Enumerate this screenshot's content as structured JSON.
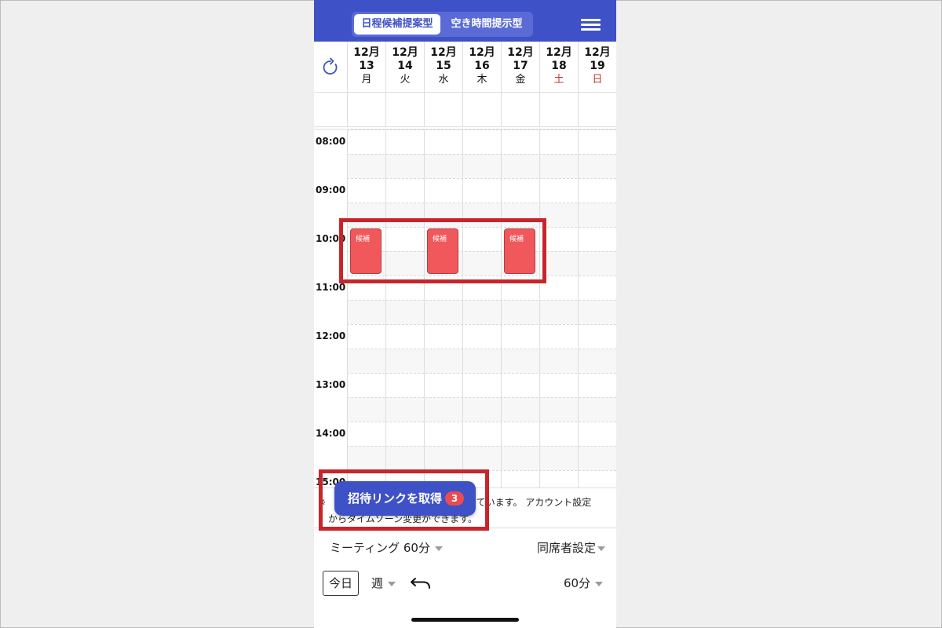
{
  "header": {
    "mode_tabs": [
      "日程候補提案型",
      "空き時間提示型"
    ],
    "active_tab": 0,
    "menu_icon": "hamburger-menu-icon",
    "color": "#3f51c7"
  },
  "days": [
    {
      "month": "12月",
      "date": "13",
      "weekday": "月",
      "weekend": false
    },
    {
      "month": "12月",
      "date": "14",
      "weekday": "火",
      "weekend": false
    },
    {
      "month": "12月",
      "date": "15",
      "weekday": "水",
      "weekend": false
    },
    {
      "month": "12月",
      "date": "16",
      "weekday": "木",
      "weekend": false
    },
    {
      "month": "12月",
      "date": "17",
      "weekday": "金",
      "weekend": false
    },
    {
      "month": "12月",
      "date": "18",
      "weekday": "土",
      "weekend": true
    },
    {
      "month": "12月",
      "date": "19",
      "weekday": "日",
      "weekend": true
    }
  ],
  "times": [
    "08:00",
    "09:00",
    "10:00",
    "11:00",
    "12:00",
    "13:00",
    "14:00",
    "15:00"
  ],
  "events": [
    {
      "label": "候補",
      "day_index": 0,
      "start": "10:00",
      "end": "11:00"
    },
    {
      "label": "候補",
      "day_index": 2,
      "start": "10:00",
      "end": "11:00"
    },
    {
      "label": "候補",
      "day_index": 4,
      "start": "10:00",
      "end": "11:00"
    }
  ],
  "event_color": "#f0585b",
  "notice": {
    "line1_start": "※",
    "line1_end": "しています。 アカウント設定",
    "line2": "からタイムゾーン変更ができます。"
  },
  "invite_button": {
    "label": "招待リンクを取得",
    "badge": "3"
  },
  "controls": {
    "meeting": "ミーティング 60分",
    "attendees": "同席者設定",
    "today": "今日",
    "view": "週",
    "interval": "60分"
  },
  "icons": {
    "refresh": "refresh-icon",
    "back": "back-arrow-icon"
  }
}
